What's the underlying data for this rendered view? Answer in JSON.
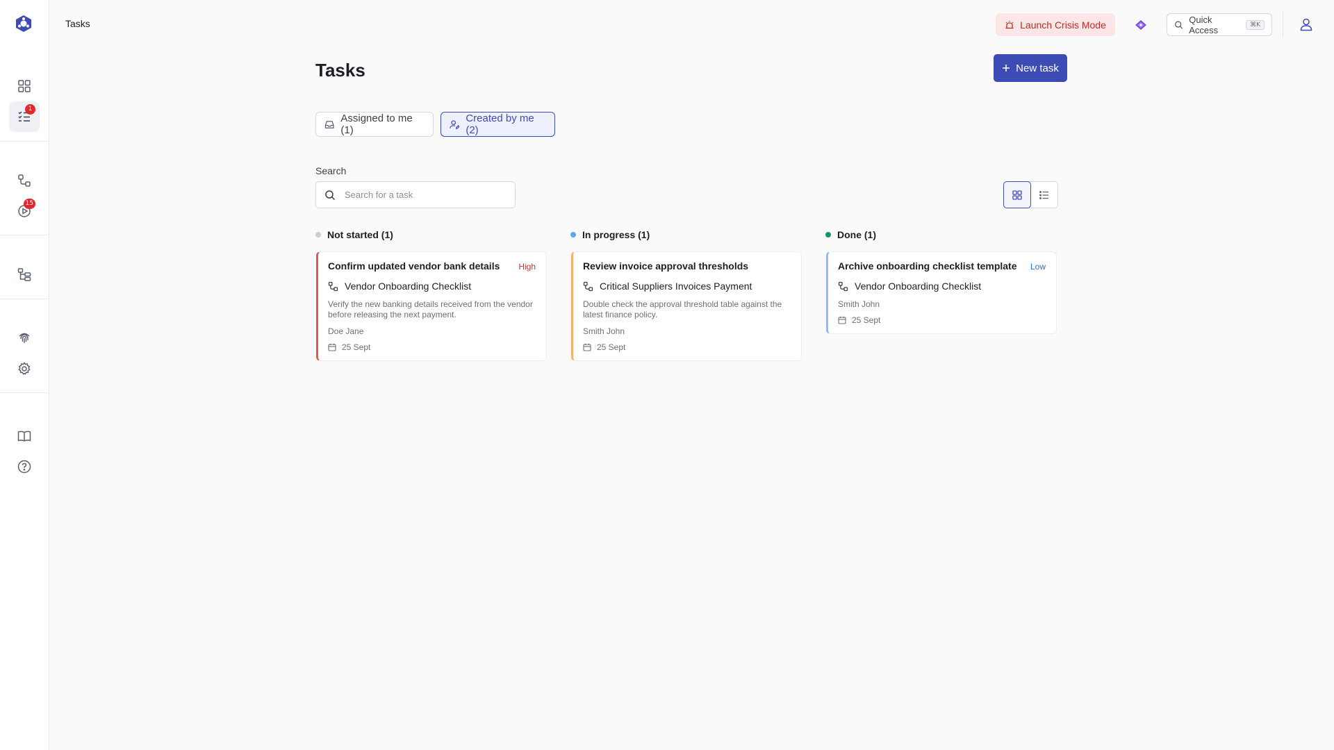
{
  "topbar": {
    "breadcrumb": "Tasks",
    "crisis_label": "Launch Crisis Mode",
    "quick_access_label": "Quick Access",
    "quick_access_shortcut": "⌘K"
  },
  "sidebar": {
    "badges": {
      "tasks": "1",
      "runs": "15"
    }
  },
  "header": {
    "title": "Tasks",
    "new_task_label": "New task"
  },
  "filters": {
    "assigned_label": "Assigned to me (1)",
    "created_label": "Created by me (2)"
  },
  "search": {
    "label": "Search",
    "placeholder": "Search for a task"
  },
  "colors": {
    "accent": "#3d4bb5",
    "high": "#d32f2f",
    "low": "#2f6fd3",
    "not_started": "#c9ccd3",
    "in_progress": "#5aa9f0",
    "done": "#16946b"
  },
  "columns": [
    {
      "title": "Not started (1)",
      "cards": [
        {
          "title": "Confirm updated vendor bank details",
          "priority": "High",
          "process": "Vendor Onboarding Checklist",
          "description": "Verify the new banking details received from the vendor before releasing the next payment.",
          "owner": "Doe Jane",
          "date": "25 Sept"
        }
      ]
    },
    {
      "title": "In progress (1)",
      "cards": [
        {
          "title": "Review invoice approval thresholds",
          "priority": "",
          "process": "Critical Suppliers Invoices Payment",
          "description": "Double check the approval threshold table against the latest finance policy.",
          "owner": "Smith John",
          "date": "25 Sept"
        }
      ]
    },
    {
      "title": "Done (1)",
      "cards": [
        {
          "title": "Archive onboarding checklist template",
          "priority": "Low",
          "process": "Vendor Onboarding Checklist",
          "description": "",
          "owner": "Smith John",
          "date": "25 Sept"
        }
      ]
    }
  ]
}
